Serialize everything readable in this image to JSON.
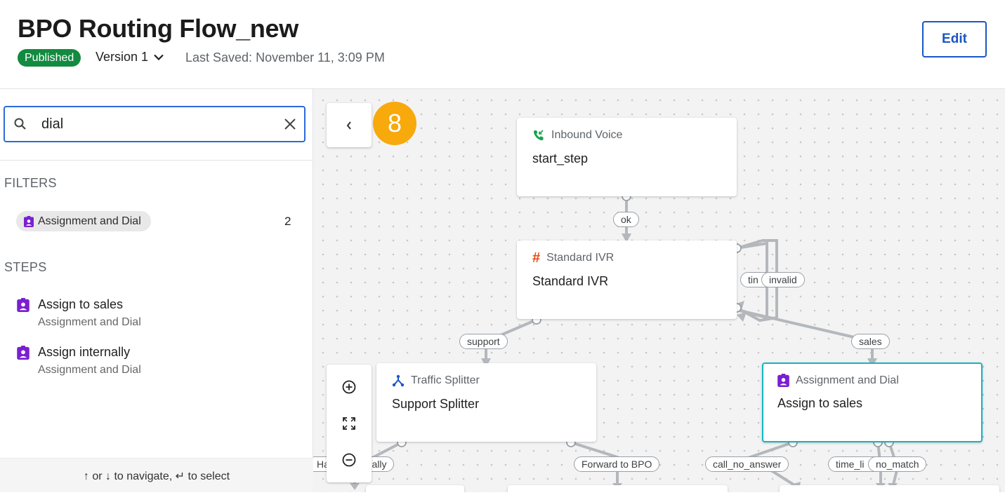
{
  "header": {
    "title": "BPO Routing Flow_new",
    "status_badge": "Published",
    "version_label": "Version 1",
    "last_saved": "Last Saved: November 11, 3:09 PM",
    "edit_label": "Edit"
  },
  "sidebar": {
    "search": {
      "value": "dial"
    },
    "filters_label": "FILTERS",
    "filters": [
      {
        "label": "Assignment and Dial",
        "count": "2"
      }
    ],
    "steps_label": "STEPS",
    "steps": [
      {
        "name": "Assign to sales",
        "type": "Assignment and Dial"
      },
      {
        "name": "Assign internally",
        "type": "Assignment and Dial"
      }
    ],
    "hint": "↑ or ↓ to navigate, ↵ to select"
  },
  "canvas": {
    "result_count": "8",
    "nodes": [
      {
        "type": "Inbound Voice",
        "title": "start_step"
      },
      {
        "type": "Standard IVR",
        "title": "Standard IVR"
      },
      {
        "type": "Traffic Splitter",
        "title": "Support Splitter"
      },
      {
        "type": "Assignment and Dial",
        "title": "Assign to sales"
      }
    ],
    "edge_labels": {
      "ok": "ok",
      "timeout_clipped": "tin",
      "invalid": "invalid",
      "support": "support",
      "sales": "sales",
      "left_clipped": "Ha",
      "internally_clipped": "rnally",
      "forward": "Forward to BPO",
      "call_no_answer": "call_no_answer",
      "time_limit_clipped": "time_li",
      "no_match": "no_match"
    }
  },
  "colors": {
    "accent": "#1a56c6",
    "published": "#128a3f",
    "bubble": "#f8a90c",
    "selected_border": "#17b5c4",
    "assignment_icon": "#7b1fd1",
    "inbound_icon": "#16a34a",
    "ivr_icon": "#e8490f",
    "splitter_icon": "#1a56c6"
  }
}
